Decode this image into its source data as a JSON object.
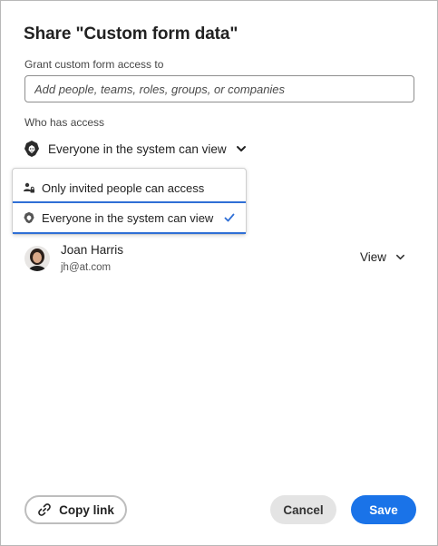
{
  "dialog": {
    "title": "Share \"Custom form data\""
  },
  "grant": {
    "label": "Grant custom form access to",
    "placeholder": "Add people, teams, roles, groups, or companies"
  },
  "access": {
    "label": "Who has access",
    "selected": "Everyone in the system can view",
    "icon": "lion-icon"
  },
  "menu": {
    "items": [
      {
        "label": "Only invited people can access",
        "icon": "people-lock-icon",
        "selected": false
      },
      {
        "label": "Everyone in the system can view",
        "icon": "lion-icon",
        "selected": true
      }
    ]
  },
  "people": [
    {
      "name": "Joan Harris",
      "email": "jh@at.com",
      "permission": "View"
    }
  ],
  "footer": {
    "copy_link": "Copy link",
    "cancel": "Cancel",
    "save": "Save"
  },
  "colors": {
    "accent": "#1a73e8",
    "menu_selected_border": "#2f6fd6",
    "cancel_bg": "#e4e4e4"
  }
}
